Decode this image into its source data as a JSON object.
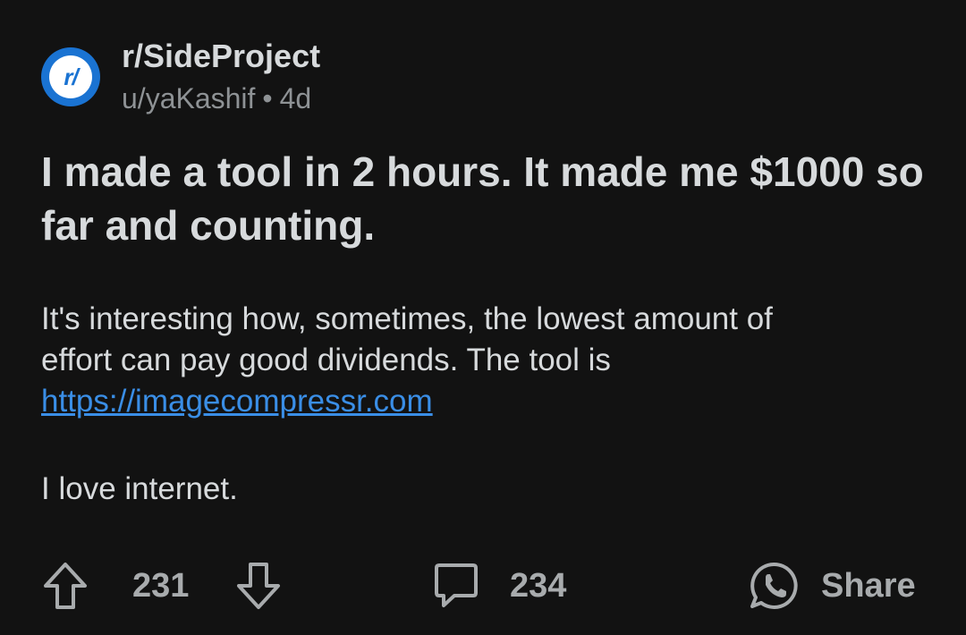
{
  "post": {
    "avatar_text": "r/",
    "subreddit": "r/SideProject",
    "username": "u/yaKashif",
    "separator": "•",
    "age": "4d",
    "title": "I made a tool in 2 hours. It made me $1000 so far and counting.",
    "body_line1": "It's interesting how, sometimes, the lowest amount of effort can pay good dividends. The tool is",
    "link": "https://imagecompressr.com",
    "body_line2": "I love internet."
  },
  "actions": {
    "upvote_icon": "arrow-up-icon",
    "votes": "231",
    "downvote_icon": "arrow-down-icon",
    "comment_icon": "comment-bubble-icon",
    "comments": "234",
    "share_icon": "whatsapp-icon",
    "share_label": "Share"
  },
  "colors": {
    "background": "#121212",
    "text": "#d7dadc",
    "muted": "#8e9295",
    "link": "#3a8ee6",
    "avatar": "#1a73d2"
  }
}
